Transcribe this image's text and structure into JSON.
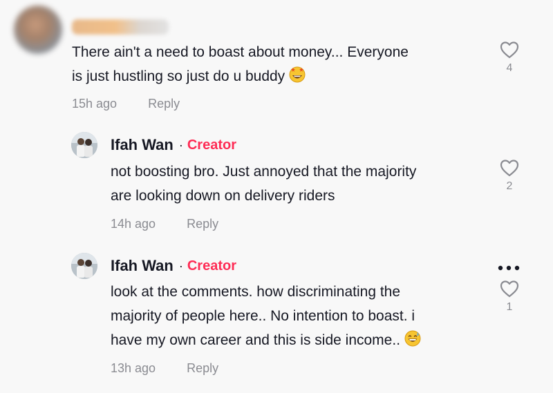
{
  "comments": [
    {
      "lines": [
        "There ain't a need to boast about money... Everyone",
        "is just hustling so just do u buddy"
      ],
      "emoji": "star-struck-emoji",
      "time": "15h ago",
      "reply_label": "Reply",
      "likes": "4"
    },
    {
      "username": "Ifah Wan",
      "separator": "·",
      "badge": "Creator",
      "lines": [
        "not boosting bro. Just annoyed that the majority",
        "are looking down on delivery riders"
      ],
      "time": "14h ago",
      "reply_label": "Reply",
      "likes": "2"
    },
    {
      "username": "Ifah Wan",
      "separator": "·",
      "badge": "Creator",
      "lines": [
        "look at the comments. how discriminating the",
        "majority of people here.. No intention to boast. i",
        "have my own career and this is side income.."
      ],
      "emoji": "grinning-sweat-emoji",
      "time": "13h ago",
      "reply_label": "Reply",
      "likes": "1"
    }
  ],
  "colors": {
    "background": "#f8f8f8",
    "text": "#161823",
    "muted": "#8a8b91",
    "creator_badge": "#fe2c55"
  },
  "icons": {
    "like": "heart-outline-icon",
    "more": "more-dots-icon"
  }
}
